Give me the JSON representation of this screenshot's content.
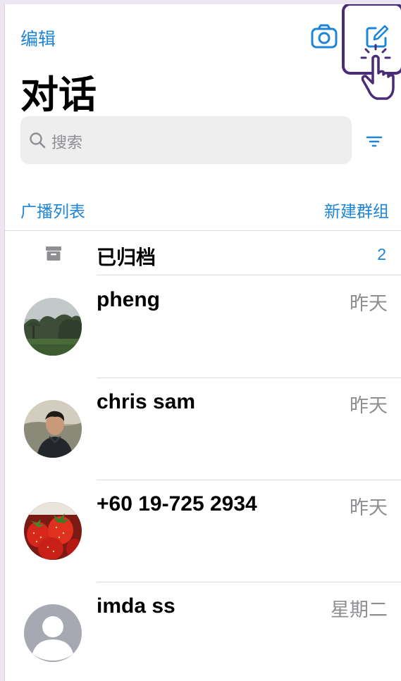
{
  "header": {
    "edit_label": "编辑",
    "title": "对话",
    "camera_icon": "camera-icon",
    "compose_icon": "compose-icon"
  },
  "search": {
    "placeholder": "搜索",
    "filter_icon": "filter-icon"
  },
  "links": {
    "broadcast_label": "广播列表",
    "new_group_label": "新建群组"
  },
  "archived": {
    "label": "已归档",
    "count": "2",
    "icon": "archive-box-icon"
  },
  "chats": [
    {
      "name": "pheng",
      "time": "昨天",
      "avatar": "landscape-photo"
    },
    {
      "name": "chris sam",
      "time": "昨天",
      "avatar": "person-photo"
    },
    {
      "name": "+60 19-725 2934",
      "time": "昨天",
      "avatar": "strawberry-photo"
    },
    {
      "name": "imda ss",
      "time": "星期二",
      "avatar": "default-person-avatar"
    }
  ],
  "colors": {
    "accent": "#1d84d6",
    "highlight": "#4a2c78",
    "secondary_text": "#8e8e93"
  }
}
